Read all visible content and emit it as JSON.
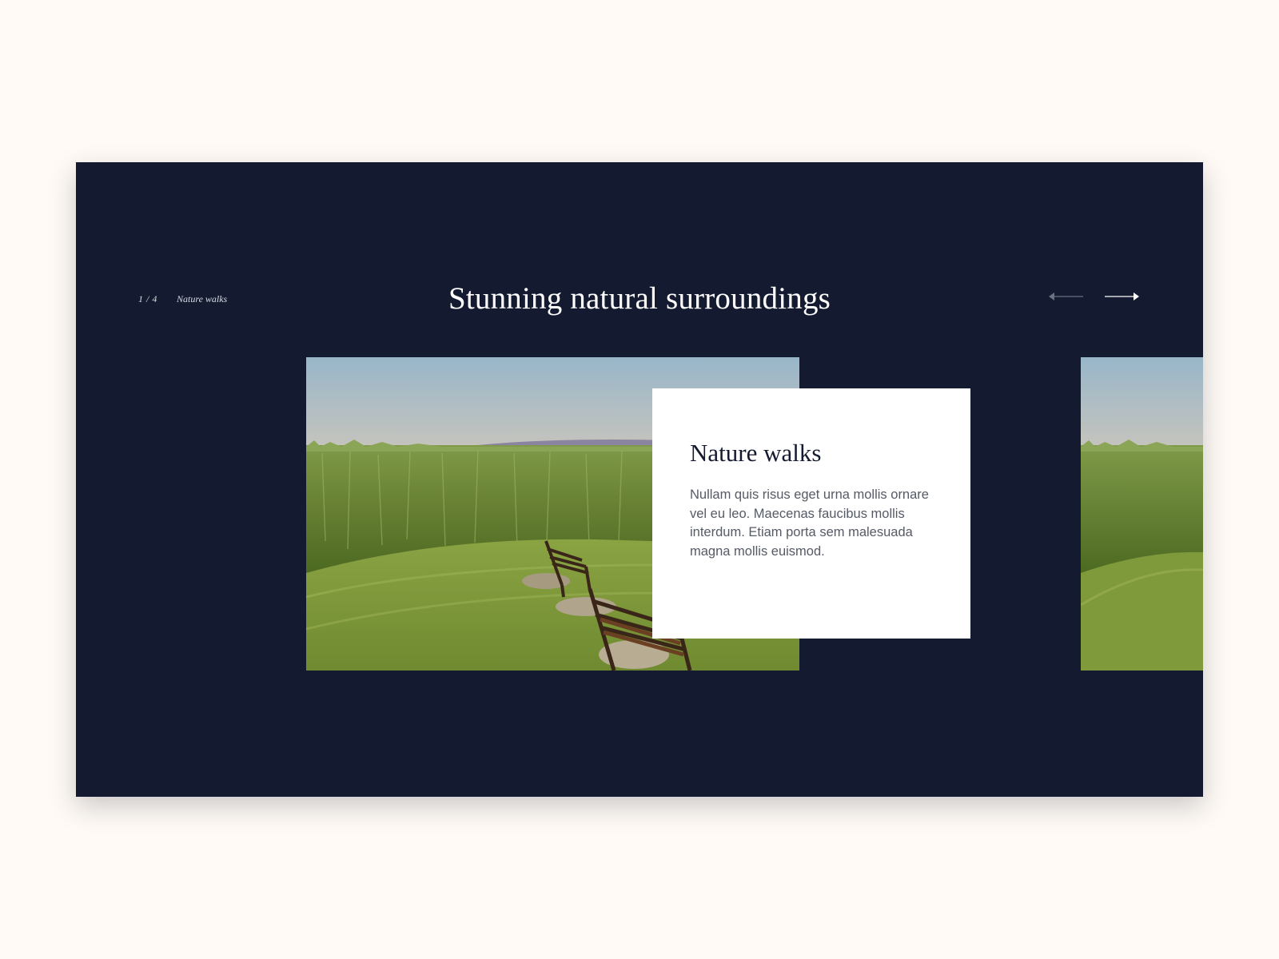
{
  "slider": {
    "counter": "1 / 4",
    "category": "Nature walks",
    "title": "Stunning natural surroundings",
    "current_slide": 1,
    "total_slides": 4
  },
  "navigation": {
    "prev_icon": "arrow-left-icon",
    "next_icon": "arrow-right-icon"
  },
  "slide": {
    "heading": "Nature walks",
    "description": "Nullam quis risus eget urna mollis ornare vel eu leo. Maecenas faucibus mollis interdum. Etiam porta sem malesuada magna mollis euismod."
  },
  "colors": {
    "page_background": "#fffaf5",
    "panel_background": "#141a2f",
    "card_background": "#ffffff",
    "title_text": "#ffffff",
    "card_heading": "#141a2f",
    "card_body": "#555a66"
  }
}
